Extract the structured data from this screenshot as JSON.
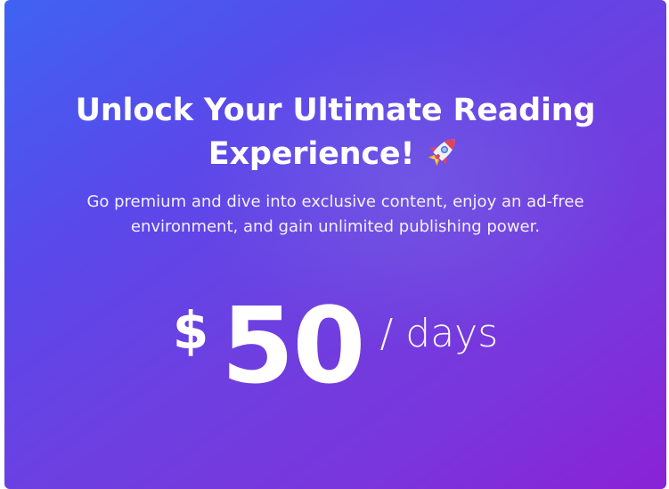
{
  "card": {
    "headline_line1": "Unlock Your Ultimate Reading",
    "headline_line2": "Experience!",
    "headline_icon": "rocket-icon",
    "subtitle_line1": "Go premium and dive into exclusive content, enjoy an ad-free",
    "subtitle_line2": "environment, and gain unlimited publishing power.",
    "price_currency": "$",
    "price_amount": "50",
    "price_period": "/ days"
  },
  "colors": {
    "gradient_start": "#3f63f3",
    "gradient_mid": "#6e3fe0",
    "gradient_end": "#8a22d6",
    "text": "#ffffff"
  }
}
